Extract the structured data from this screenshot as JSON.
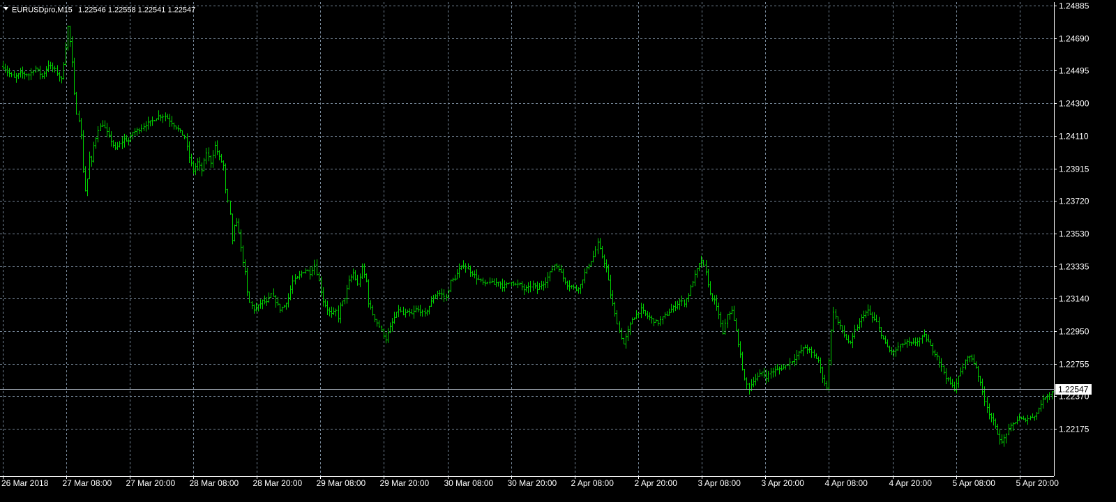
{
  "header": {
    "symbol": "EURUSDpro,M15",
    "ohlc": "1.22546 1.22558 1.22541 1.22547"
  },
  "chart_data": {
    "type": "bar",
    "symbol": "EURUSDpro",
    "timeframe": "M15",
    "y_ticks": [
      "1.24885",
      "1.24690",
      "1.24495",
      "1.24300",
      "1.24110",
      "1.23915",
      "1.23720",
      "1.23530",
      "1.23335",
      "1.23140",
      "1.22950",
      "1.22755",
      "1.22547",
      "1.22370",
      "1.22175"
    ],
    "ylim": [
      1.2202,
      1.2489
    ],
    "x_ticks": [
      "26 Mar 2018",
      "27 Mar 08:00",
      "27 Mar 20:00",
      "28 Mar 08:00",
      "28 Mar 20:00",
      "29 Mar 08:00",
      "29 Mar 20:00",
      "30 Mar 08:00",
      "30 Mar 20:00",
      "2 Apr 08:00",
      "2 Apr 20:00",
      "3 Apr 08:00",
      "3 Apr 20:00",
      "4 Apr 08:00",
      "4 Apr 20:00",
      "5 Apr 08:00",
      "5 Apr 20:00"
    ],
    "current_price": "1.22547",
    "price_path": [
      [
        0,
        1.245
      ],
      [
        2,
        1.2447
      ],
      [
        5,
        1.2443
      ],
      [
        8,
        1.2446
      ],
      [
        12,
        1.2445
      ],
      [
        15,
        1.2449
      ],
      [
        18,
        1.2444
      ],
      [
        21,
        1.2451
      ],
      [
        24,
        1.2448
      ],
      [
        27,
        1.2442
      ],
      [
        29,
        1.2462
      ],
      [
        30,
        1.2474
      ],
      [
        31,
        1.2465
      ],
      [
        32,
        1.2452
      ],
      [
        33,
        1.2433
      ],
      [
        34,
        1.2422
      ],
      [
        35,
        1.2418
      ],
      [
        36,
        1.2408
      ],
      [
        37,
        1.2387
      ],
      [
        38,
        1.2375
      ],
      [
        39,
        1.2382
      ],
      [
        40,
        1.2395
      ],
      [
        41,
        1.2392
      ],
      [
        42,
        1.2402
      ],
      [
        44,
        1.2412
      ],
      [
        46,
        1.2415
      ],
      [
        48,
        1.241
      ],
      [
        50,
        1.2405
      ],
      [
        52,
        1.24
      ],
      [
        54,
        1.2403
      ],
      [
        56,
        1.2406
      ],
      [
        58,
        1.2405
      ],
      [
        60,
        1.241
      ],
      [
        63,
        1.2412
      ],
      [
        66,
        1.2415
      ],
      [
        69,
        1.2417
      ],
      [
        72,
        1.242
      ],
      [
        75,
        1.242
      ],
      [
        78,
        1.2416
      ],
      [
        81,
        1.2412
      ],
      [
        84,
        1.2407
      ],
      [
        86,
        1.2395
      ],
      [
        88,
        1.2387
      ],
      [
        90,
        1.2392
      ],
      [
        92,
        1.2387
      ],
      [
        94,
        1.2398
      ],
      [
        96,
        1.2392
      ],
      [
        98,
        1.2402
      ],
      [
        100,
        1.2395
      ],
      [
        102,
        1.239
      ],
      [
        103,
        1.2375
      ],
      [
        104,
        1.2368
      ],
      [
        105,
        1.236
      ],
      [
        106,
        1.2345
      ],
      [
        107,
        1.2353
      ],
      [
        108,
        1.2355
      ],
      [
        109,
        1.235
      ],
      [
        110,
        1.234
      ],
      [
        111,
        1.2332
      ],
      [
        112,
        1.2325
      ],
      [
        113,
        1.2313
      ],
      [
        114,
        1.2307
      ],
      [
        116,
        1.2303
      ],
      [
        118,
        1.2305
      ],
      [
        120,
        1.2308
      ],
      [
        122,
        1.2307
      ],
      [
        124,
        1.2312
      ],
      [
        126,
        1.2308
      ],
      [
        128,
        1.2303
      ],
      [
        130,
        1.2305
      ],
      [
        132,
        1.231
      ],
      [
        134,
        1.232
      ],
      [
        136,
        1.2322
      ],
      [
        138,
        1.2325
      ],
      [
        140,
        1.2327
      ],
      [
        142,
        1.2325
      ],
      [
        144,
        1.233
      ],
      [
        146,
        1.232
      ],
      [
        148,
        1.2308
      ],
      [
        150,
        1.2303
      ],
      [
        152,
        1.23
      ],
      [
        154,
        1.2302
      ],
      [
        155,
        1.2298
      ],
      [
        156,
        1.2305
      ],
      [
        158,
        1.231
      ],
      [
        160,
        1.232
      ],
      [
        162,
        1.2325
      ],
      [
        164,
        1.2318
      ],
      [
        166,
        1.2328
      ],
      [
        168,
        1.232
      ],
      [
        169,
        1.2307
      ],
      [
        171,
        1.23
      ],
      [
        173,
        1.2295
      ],
      [
        175,
        1.229
      ],
      [
        177,
        1.2285
      ],
      [
        179,
        1.2292
      ],
      [
        181,
        1.2298
      ],
      [
        183,
        1.2303
      ],
      [
        185,
        1.23
      ],
      [
        187,
        1.2301
      ],
      [
        189,
        1.23
      ],
      [
        191,
        1.2303
      ],
      [
        193,
        1.2302
      ],
      [
        195,
        1.23
      ],
      [
        197,
        1.2305
      ],
      [
        199,
        1.231
      ],
      [
        201,
        1.2313
      ],
      [
        203,
        1.2312
      ],
      [
        205,
        1.231
      ],
      [
        207,
        1.232
      ],
      [
        209,
        1.2322
      ],
      [
        211,
        1.2327
      ],
      [
        213,
        1.233
      ],
      [
        215,
        1.2327
      ],
      [
        217,
        1.2325
      ],
      [
        219,
        1.2322
      ],
      [
        221,
        1.232
      ],
      [
        223,
        1.2318
      ],
      [
        225,
        1.232
      ],
      [
        227,
        1.2318
      ],
      [
        229,
        1.232
      ],
      [
        231,
        1.2317
      ],
      [
        233,
        1.2318
      ],
      [
        235,
        1.232
      ],
      [
        237,
        1.2318
      ],
      [
        239,
        1.2318
      ],
      [
        241,
        1.2315
      ],
      [
        243,
        1.2316
      ],
      [
        245,
        1.2318
      ],
      [
        247,
        1.2315
      ],
      [
        249,
        1.2318
      ],
      [
        251,
        1.232
      ],
      [
        253,
        1.2325
      ],
      [
        255,
        1.233
      ],
      [
        257,
        1.2328
      ],
      [
        259,
        1.2322
      ],
      [
        261,
        1.2318
      ],
      [
        263,
        1.2317
      ],
      [
        265,
        1.2315
      ],
      [
        267,
        1.2318
      ],
      [
        269,
        1.2325
      ],
      [
        271,
        1.233
      ],
      [
        273,
        1.2335
      ],
      [
        275,
        1.2343
      ],
      [
        277,
        1.2335
      ],
      [
        279,
        1.2328
      ],
      [
        281,
        1.2312
      ],
      [
        283,
        1.23
      ],
      [
        285,
        1.229
      ],
      [
        287,
        1.2282
      ],
      [
        289,
        1.229
      ],
      [
        291,
        1.2297
      ],
      [
        293,
        1.23
      ],
      [
        295,
        1.2303
      ],
      [
        297,
        1.23
      ],
      [
        299,
        1.2298
      ],
      [
        301,
        1.2296
      ],
      [
        303,
        1.2295
      ],
      [
        305,
        1.2298
      ],
      [
        307,
        1.23
      ],
      [
        309,
        1.2303
      ],
      [
        311,
        1.2305
      ],
      [
        313,
        1.2308
      ],
      [
        315,
        1.2307
      ],
      [
        317,
        1.2312
      ],
      [
        319,
        1.232
      ],
      [
        321,
        1.2327
      ],
      [
        323,
        1.2333
      ],
      [
        325,
        1.2325
      ],
      [
        327,
        1.2312
      ],
      [
        329,
        1.2308
      ],
      [
        331,
        1.23
      ],
      [
        333,
        1.2288
      ],
      [
        335,
        1.23
      ],
      [
        337,
        1.2302
      ],
      [
        339,
        1.229
      ],
      [
        341,
        1.2275
      ],
      [
        343,
        1.226
      ],
      [
        345,
        1.2255
      ],
      [
        347,
        1.226
      ],
      [
        349,
        1.2262
      ],
      [
        351,
        1.2265
      ],
      [
        353,
        1.2262
      ],
      [
        355,
        1.2265
      ],
      [
        357,
        1.2266
      ],
      [
        359,
        1.2267
      ],
      [
        361,
        1.2268
      ],
      [
        363,
        1.227
      ],
      [
        365,
        1.2272
      ],
      [
        367,
        1.2275
      ],
      [
        369,
        1.2278
      ],
      [
        371,
        1.228
      ],
      [
        373,
        1.2278
      ],
      [
        375,
        1.2275
      ],
      [
        377,
        1.2272
      ],
      [
        379,
        1.2262
      ],
      [
        381,
        1.2255
      ],
      [
        383,
        1.229
      ],
      [
        384,
        1.2302
      ],
      [
        386,
        1.2295
      ],
      [
        388,
        1.229
      ],
      [
        390,
        1.2285
      ],
      [
        392,
        1.2282
      ],
      [
        394,
        1.229
      ],
      [
        396,
        1.2295
      ],
      [
        398,
        1.23
      ],
      [
        400,
        1.2302
      ],
      [
        402,
        1.2298
      ],
      [
        404,
        1.2295
      ],
      [
        406,
        1.2288
      ],
      [
        408,
        1.2282
      ],
      [
        410,
        1.2278
      ],
      [
        412,
        1.2277
      ],
      [
        414,
        1.228
      ],
      [
        416,
        1.2282
      ],
      [
        418,
        1.2283
      ],
      [
        420,
        1.2282
      ],
      [
        422,
        1.2283
      ],
      [
        424,
        1.2285
      ],
      [
        426,
        1.2287
      ],
      [
        428,
        1.2283
      ],
      [
        430,
        1.2278
      ],
      [
        432,
        1.2275
      ],
      [
        434,
        1.2268
      ],
      [
        436,
        1.2262
      ],
      [
        438,
        1.2258
      ],
      [
        440,
        1.2255
      ],
      [
        442,
        1.2262
      ],
      [
        444,
        1.2268
      ],
      [
        446,
        1.2275
      ],
      [
        448,
        1.2273
      ],
      [
        450,
        1.2268
      ],
      [
        452,
        1.2258
      ],
      [
        454,
        1.2248
      ],
      [
        456,
        1.224
      ],
      [
        458,
        1.2235
      ],
      [
        460,
        1.2228
      ],
      [
        462,
        1.2222
      ],
      [
        464,
        1.2228
      ],
      [
        466,
        1.2232
      ],
      [
        468,
        1.2235
      ],
      [
        470,
        1.2237
      ],
      [
        472,
        1.2236
      ],
      [
        474,
        1.2237
      ],
      [
        476,
        1.2238
      ],
      [
        478,
        1.224
      ],
      [
        480,
        1.2246
      ],
      [
        482,
        1.225
      ],
      [
        484,
        1.2252
      ],
      [
        486,
        1.2254
      ],
      [
        487,
        1.22547
      ]
    ]
  },
  "colors": {
    "background": "#000000",
    "grid": "#778899",
    "candle": "#00d000",
    "text": "#ffffff",
    "axis_line": "#ffffff",
    "price_line": "#9aa3ad",
    "price_label_bg": "#ffffff",
    "price_label_text": "#000000"
  }
}
